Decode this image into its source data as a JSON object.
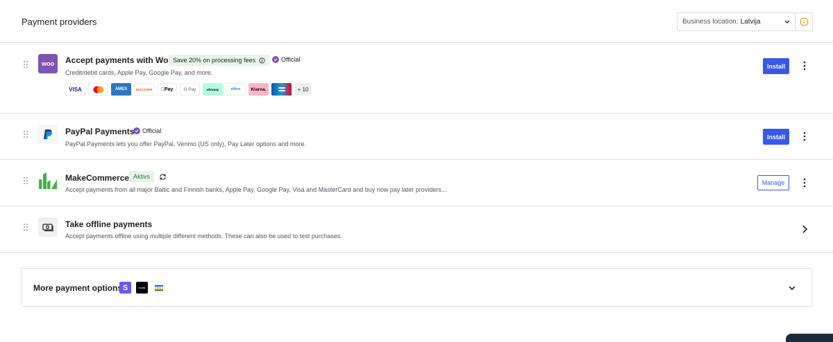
{
  "header": {
    "title": "Payment providers",
    "location_label": "Business location:",
    "location_value": "Latvija",
    "info_icon": "info-icon"
  },
  "providers": [
    {
      "name": "Accept payments with Woo",
      "logo_text": "woo",
      "promo_badge": "Save 20% on processing fees",
      "official_label": "Official",
      "description": "Credit/debit cards, Apple Pay, Google Pay, and more.",
      "payment_methods": [
        "VISA",
        "Mastercard",
        "AMEX",
        "DISCOVER",
        "Pay",
        "G Pay",
        "afterpay",
        "affirm",
        "Klarna.",
        "Cartes Bancaires"
      ],
      "more_methods": "+ 10",
      "action": "Install"
    },
    {
      "name": "PayPal Payments",
      "official_label": "Official",
      "description": "PayPal Payments lets you offer PayPal, Venmo (US only), Pay Later options and more.",
      "action": "Install"
    },
    {
      "name": "MakeCommerce",
      "status_badge": "Aktivs",
      "description": "Accept payments from all major Baltic and Finnish banks, Apple Pay, Google Pay, Visa and MasterCard and buy now pay later providers...",
      "action": "Manage"
    },
    {
      "name": "Take offline payments",
      "description": "Accept payments offline using multiple different methods. These can also be used to test purchases."
    }
  ],
  "more_options": {
    "title": "More payment options",
    "icons": [
      "stripe-icon",
      "mollie-icon",
      "paysera-icon"
    ],
    "mollie_text": "mollie",
    "stripe_text": "S"
  },
  "colors": {
    "primary": "#3858e9",
    "woo_purple": "#7f54b3",
    "success_bg": "#e6f4ea",
    "success_text": "#1a7f37",
    "warning": "#dba617"
  }
}
